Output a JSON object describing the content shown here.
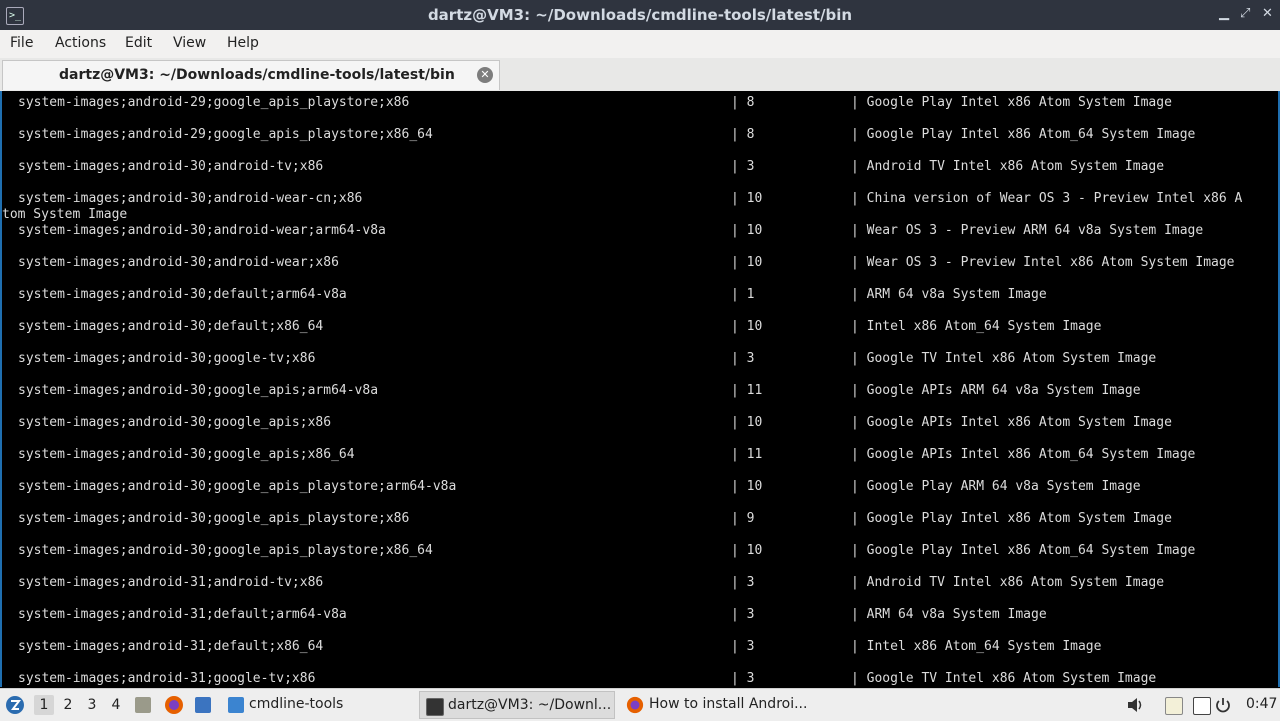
{
  "window": {
    "title": "dartz@VM3: ~/Downloads/cmdline-tools/latest/bin",
    "minimize": "▁",
    "maximize": "⤢",
    "close": "✕"
  },
  "menu": [
    "File",
    "Actions",
    "Edit",
    "View",
    "Help"
  ],
  "tab": {
    "title": "dartz@VM3: ~/Downloads/cmdline-tools/latest/bin",
    "close": "✕"
  },
  "terminal_rows": [
    {
      "path": "system-images;android-29;google_apis_playstore;x86",
      "version": "| 8",
      "desc": "| Google Play Intel x86 Atom System Image"
    },
    {
      "path": "system-images;android-29;google_apis_playstore;x86_64",
      "version": "| 8",
      "desc": "| Google Play Intel x86 Atom_64 System Image"
    },
    {
      "path": "system-images;android-30;android-tv;x86",
      "version": "| 3",
      "desc": "| Android TV Intel x86 Atom System Image"
    },
    {
      "path": "system-images;android-30;android-wear-cn;x86",
      "version": "| 10",
      "desc": "| China version of Wear OS 3 - Preview Intel x86 A",
      "wrap": "tom System Image"
    },
    {
      "path": "system-images;android-30;android-wear;arm64-v8a",
      "version": "| 10",
      "desc": "| Wear OS 3 - Preview ARM 64 v8a System Image"
    },
    {
      "path": "system-images;android-30;android-wear;x86",
      "version": "| 10",
      "desc": "| Wear OS 3 - Preview Intel x86 Atom System Image"
    },
    {
      "path": "system-images;android-30;default;arm64-v8a",
      "version": "| 1",
      "desc": "| ARM 64 v8a System Image"
    },
    {
      "path": "system-images;android-30;default;x86_64",
      "version": "| 10",
      "desc": "| Intel x86 Atom_64 System Image"
    },
    {
      "path": "system-images;android-30;google-tv;x86",
      "version": "| 3",
      "desc": "| Google TV Intel x86 Atom System Image"
    },
    {
      "path": "system-images;android-30;google_apis;arm64-v8a",
      "version": "| 11",
      "desc": "| Google APIs ARM 64 v8a System Image"
    },
    {
      "path": "system-images;android-30;google_apis;x86",
      "version": "| 10",
      "desc": "| Google APIs Intel x86 Atom System Image"
    },
    {
      "path": "system-images;android-30;google_apis;x86_64",
      "version": "| 11",
      "desc": "| Google APIs Intel x86 Atom_64 System Image"
    },
    {
      "path": "system-images;android-30;google_apis_playstore;arm64-v8a",
      "version": "| 10",
      "desc": "| Google Play ARM 64 v8a System Image"
    },
    {
      "path": "system-images;android-30;google_apis_playstore;x86",
      "version": "| 9",
      "desc": "| Google Play Intel x86 Atom System Image"
    },
    {
      "path": "system-images;android-30;google_apis_playstore;x86_64",
      "version": "| 10",
      "desc": "| Google Play Intel x86 Atom_64 System Image"
    },
    {
      "path": "system-images;android-31;android-tv;x86",
      "version": "| 3",
      "desc": "| Android TV Intel x86 Atom System Image"
    },
    {
      "path": "system-images;android-31;default;arm64-v8a",
      "version": "| 3",
      "desc": "| ARM 64 v8a System Image"
    },
    {
      "path": "system-images;android-31;default;x86_64",
      "version": "| 3",
      "desc": "| Intel x86 Atom_64 System Image"
    },
    {
      "path": "system-images;android-31;google-tv;x86",
      "version": "| 3",
      "desc": "| Google TV Intel x86 Atom System Image"
    }
  ],
  "taskbar": {
    "workspaces": [
      "1",
      "2",
      "3",
      "4"
    ],
    "active_workspace": "1",
    "folder_task": "cmdline-tools",
    "terminal_task": "dartz@VM3: ~/Downl...",
    "browser_task": "How to install Androi...",
    "clock": "0:47"
  },
  "colors": {
    "titlebar": "#2f343f",
    "terminal_bg": "#000000",
    "terminal_fg": "#dcdcdc",
    "accent": "#1f6fb0"
  },
  "icons": [
    "terminal-icon",
    "start-menu-icon",
    "file-manager-icon",
    "firefox-icon",
    "desktop-icon",
    "folder-icon",
    "volume-icon",
    "clipboard-icon",
    "display-icon",
    "power-icon"
  ]
}
